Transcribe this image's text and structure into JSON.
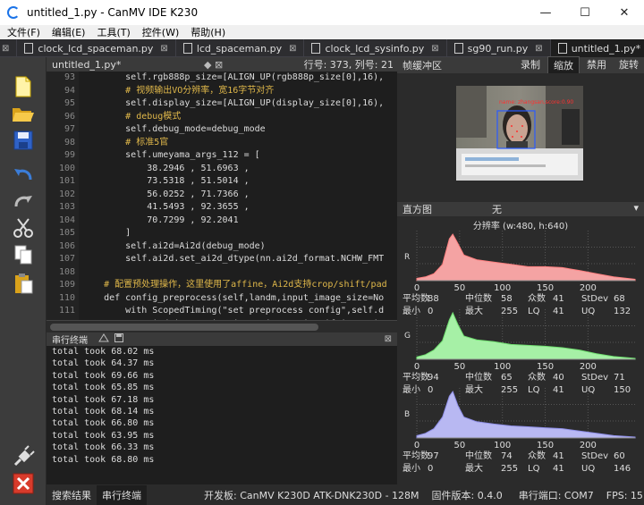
{
  "window": {
    "title": "untitled_1.py - CanMV IDE K230",
    "min": "—",
    "max": "☐",
    "close": "✕"
  },
  "menu": [
    "文件(F)",
    "编辑(E)",
    "工具(T)",
    "控件(W)",
    "帮助(H)"
  ],
  "tabs": [
    {
      "label": "clock_lcd_spaceman.py",
      "close": "⊠"
    },
    {
      "label": "lcd_spaceman.py",
      "close": "⊠"
    },
    {
      "label": "clock_lcd_sysinfo.py",
      "close": "⊠"
    },
    {
      "label": "sg90_run.py",
      "close": "⊠"
    },
    {
      "label": "untitled_1.py*",
      "close": "⊠"
    }
  ],
  "editor": {
    "filename": "untitled_1.py*",
    "controls": "◆  ⊠",
    "position": "行号: 373, 列号: 21",
    "lines": [
      {
        "n": "93",
        "t": "        self.rgb888p_size=[ALIGN_UP(rgb888p_size[0],16),",
        "c": "#dcdcdc"
      },
      {
        "n": "94",
        "t": "        # 视频输出VO分辨率，宽16字节对齐",
        "c": "#e0b84a"
      },
      {
        "n": "95",
        "t": "        self.display_size=[ALIGN_UP(display_size[0],16),",
        "c": "#dcdcdc"
      },
      {
        "n": "96",
        "t": "        # debug模式",
        "c": "#e0b84a"
      },
      {
        "n": "97",
        "t": "        self.debug_mode=debug_mode",
        "c": "#dcdcdc"
      },
      {
        "n": "98",
        "t": "        # 标准5官",
        "c": "#e0b84a"
      },
      {
        "n": "99",
        "t": "        self.umeyama_args_112 = [",
        "c": "#dcdcdc"
      },
      {
        "n": "100",
        "t": "            38.2946 , 51.6963 ,",
        "c": "#dcdcdc"
      },
      {
        "n": "101",
        "t": "            73.5318 , 51.5014 ,",
        "c": "#dcdcdc"
      },
      {
        "n": "102",
        "t": "            56.0252 , 71.7366 ,",
        "c": "#dcdcdc"
      },
      {
        "n": "103",
        "t": "            41.5493 , 92.3655 ,",
        "c": "#dcdcdc"
      },
      {
        "n": "104",
        "t": "            70.7299 , 92.2041",
        "c": "#dcdcdc"
      },
      {
        "n": "105",
        "t": "        ]",
        "c": "#dcdcdc"
      },
      {
        "n": "106",
        "t": "        self.ai2d=Ai2d(debug_mode)",
        "c": "#dcdcdc"
      },
      {
        "n": "107",
        "t": "        self.ai2d.set_ai2d_dtype(nn.ai2d_format.NCHW_FMT",
        "c": "#dcdcdc"
      },
      {
        "n": "108",
        "t": "",
        "c": "#dcdcdc"
      },
      {
        "n": "109",
        "t": "    # 配置预处理操作，这里使用了affine，Ai2d支持crop/shift/pad",
        "c": "#e0b84a"
      },
      {
        "n": "110",
        "t": "    def config_preprocess(self,landm,input_image_size=No",
        "c": "#dcdcdc"
      },
      {
        "n": "111",
        "t": "        with ScopedTiming(\"set preprocess config\",self.d",
        "c": "#dcdcdc"
      },
      {
        "n": "112",
        "t": "            ai2d_input_size=input_image_size if input_im",
        "c": "#dcdcdc"
      }
    ]
  },
  "terminal": {
    "title": "串行终端",
    "close": "⊠",
    "lines": [
      "total took 68.02 ms",
      "total took 64.37 ms",
      "total took 69.66 ms",
      "total took 65.85 ms",
      "total took 67.18 ms",
      "total took 68.14 ms",
      "total took 66.80 ms",
      "total took 63.95 ms",
      "total took 66.33 ms",
      "total took 68.80 ms"
    ]
  },
  "bottom_tabs": [
    "搜索结果",
    "串行终端"
  ],
  "status": {
    "board": "开发板: CanMV K230D ATK-DNK230D - 128M",
    "firmware": "固件版本: 0.4.0",
    "port": "串行端口: COM7",
    "fps": "FPS:  15.4"
  },
  "framebuffer": {
    "title": "帧缓冲区",
    "buttons": [
      "录制",
      "缩放",
      "禁用",
      "旋转"
    ],
    "detection_label": "name: zhangsan,score:0.90"
  },
  "histogram": {
    "title": "直方图",
    "mode": "无",
    "resolution": "分辨率 (w:480, h:640)",
    "ticks": [
      "0",
      "50",
      "100",
      "150",
      "200"
    ],
    "channels": [
      {
        "letter": "R",
        "color": "#f4a3a3",
        "stroke": "#ff8080",
        "labels": {
          "mean": "平均数",
          "median": "中位数",
          "mode": "众数",
          "stdev": "StDev",
          "min": "最小",
          "max": "最大",
          "lq": "LQ",
          "uq": "UQ"
        },
        "values": {
          "mean": "88",
          "median": "58",
          "mode": "41",
          "stdev": "68",
          "min": "0",
          "max": "255",
          "lq": "41",
          "uq": "132"
        }
      },
      {
        "letter": "G",
        "color": "#a6f0a6",
        "stroke": "#70e070",
        "labels": {
          "mean": "平均数",
          "median": "中位数",
          "mode": "众数",
          "stdev": "StDev",
          "min": "最小",
          "max": "最大",
          "lq": "LQ",
          "uq": "UQ"
        },
        "values": {
          "mean": "94",
          "median": "65",
          "mode": "40",
          "stdev": "71",
          "min": "0",
          "max": "255",
          "lq": "41",
          "uq": "150"
        }
      },
      {
        "letter": "B",
        "color": "#b8b8f2",
        "stroke": "#8f8fe8",
        "labels": {
          "mean": "平均数",
          "median": "中位数",
          "mode": "众数",
          "stdev": "StDev",
          "min": "最小",
          "max": "最大",
          "lq": "LQ",
          "uq": "UQ"
        },
        "values": {
          "mean": "97",
          "median": "74",
          "mode": "41",
          "stdev": "60",
          "min": "0",
          "max": "255",
          "lq": "41",
          "uq": "146"
        }
      }
    ]
  }
}
